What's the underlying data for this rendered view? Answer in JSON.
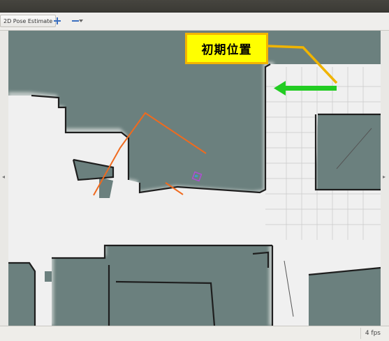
{
  "toolbar": {
    "pose_estimate_label": "2D Pose Estimate",
    "icons": [
      "plus-icon",
      "minus-icon",
      "dropdown-arrow-icon"
    ]
  },
  "annotation": {
    "text": "初期位置",
    "box_fill": "#ffff00",
    "box_border": "#f3b400",
    "arrow_color": "#22cc22",
    "leader_line_color": "#f0b400"
  },
  "map": {
    "unknown_color": "#6b807e",
    "free_color": "#f0f0f0",
    "wall_color": "#1e1e1e",
    "path_color": "#f06a1e",
    "robot_marker_color": "#b14cd6"
  },
  "status": {
    "fps": "4 fps"
  }
}
